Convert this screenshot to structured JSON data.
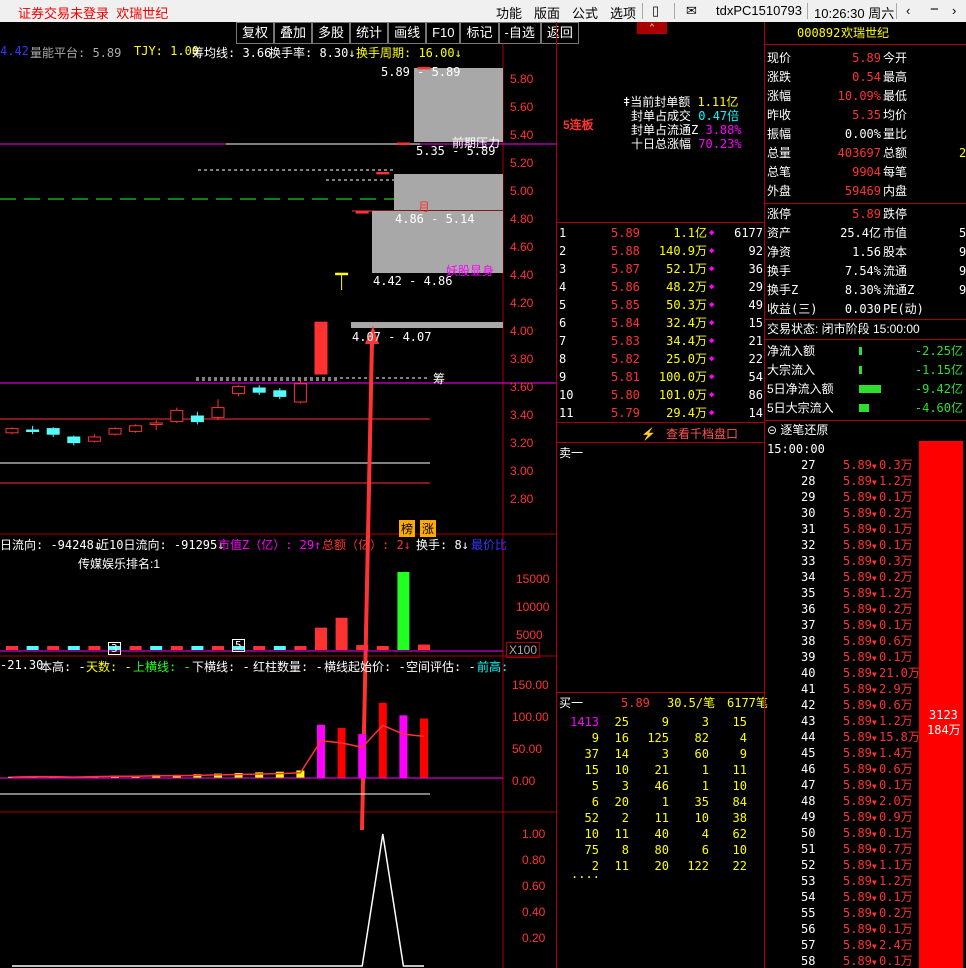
{
  "topbar": {
    "warning": "证券交易未登录",
    "stock_name": "欢瑞世纪",
    "menus": [
      "功能",
      "版面",
      "公式",
      "选项"
    ],
    "host": "tdxPC1510793",
    "time": "10:26:30 周六"
  },
  "menu": [
    "复权",
    "叠加",
    "多股",
    "统计",
    "画线",
    "F10",
    "标记",
    "-自选",
    "返回"
  ],
  "indicators": {
    "row1": [
      {
        "t": "4.42",
        "c": "#33f"
      },
      {
        "t": "量能平台: 5.89",
        "c": "#aaa"
      },
      {
        "t": "TJY: 1.00",
        "c": "#ff0"
      },
      {
        "t": "筹均线: 3.66",
        "c": "#fff"
      },
      {
        "t": "换手率: 8.30↓",
        "c": "#fff"
      },
      {
        "t": "换手周期: 16.00↓",
        "c": "#ff0"
      }
    ],
    "row2": [
      {
        "t": "日流向: -94248↓",
        "c": "#fff"
      },
      {
        "t": "近10日流向: -91295↓",
        "c": "#fff"
      },
      {
        "t": "市值Z（亿）: 29↑",
        "c": "#f0f"
      },
      {
        "t": "总额（亿）: 2↓",
        "c": "#f33"
      },
      {
        "t": "换手: 8↓",
        "c": "#fff"
      },
      {
        "t": "最价比",
        "c": "#33f"
      }
    ],
    "row3": [
      {
        "t": "-21.30",
        "c": "#fff"
      },
      {
        "t": "本高: -",
        "c": "#fff"
      },
      {
        "t": "天数: -",
        "c": "#ff0"
      },
      {
        "t": "上横线: -",
        "c": "#2f2"
      },
      {
        "t": "下横线: -",
        "c": "#fff"
      },
      {
        "t": "红柱数量: -",
        "c": "#fff"
      },
      {
        "t": "横线起始价: -",
        "c": "#fff"
      },
      {
        "t": "空间评估: -",
        "c": "#fff"
      },
      {
        "t": "前高:",
        "c": "#0ff"
      }
    ]
  },
  "price_axis": [
    "5.80",
    "5.60",
    "5.40",
    "5.20",
    "5.00",
    "4.80",
    "4.60",
    "4.40",
    "4.20",
    "4.00",
    "3.80",
    "3.60",
    "3.40",
    "3.20",
    "3.00",
    "2.80"
  ],
  "vol_axis": [
    "15000",
    "10000",
    "5000",
    "X100"
  ],
  "ind_axis": [
    "150.00",
    "100.00",
    "50.00",
    "0.00"
  ],
  "bot_axis": [
    "1.00",
    "0.80",
    "0.60",
    "0.40",
    "0.20"
  ],
  "annotations": {
    "p1": "5.89 - 5.89",
    "p2": "前期压力",
    "p3": "5.35 - 5.89",
    "p4": "4.86 - 5.14",
    "p5": "月",
    "p6": "妖股显身",
    "p7": "4.42 - 4.86",
    "p8": "4.07 - 4.07",
    "p9": "筹",
    "rank": "传媒娱乐排名:1",
    "bang": "榜",
    "zhang": "涨",
    "box3": "3",
    "box5": "5"
  },
  "mid": {
    "limit_tag": "5连板",
    "seal": [
      {
        "l": "当前封单额",
        "v": "1.11亿"
      },
      {
        "l": "封单占成交",
        "v": "0.47倍"
      },
      {
        "l": "封单占流通Z",
        "v": "3.88%"
      },
      {
        "l": "十日总涨幅",
        "v": "70.23%"
      }
    ],
    "queue": [
      [
        "1",
        "5.89",
        "1.1亿",
        "6177"
      ],
      [
        "2",
        "5.88",
        "140.9万",
        "92"
      ],
      [
        "3",
        "5.87",
        "52.1万",
        "36"
      ],
      [
        "4",
        "5.86",
        "48.2万",
        "29"
      ],
      [
        "5",
        "5.85",
        "50.3万",
        "49"
      ],
      [
        "6",
        "5.84",
        "32.4万",
        "15"
      ],
      [
        "7",
        "5.83",
        "34.4万",
        "21"
      ],
      [
        "8",
        "5.82",
        "25.0万",
        "22"
      ],
      [
        "9",
        "5.81",
        "100.0万",
        "54"
      ],
      [
        "10",
        "5.80",
        "101.0万",
        "86"
      ],
      [
        "11",
        "5.79",
        "29.4万",
        "14"
      ]
    ],
    "depth_link": "查看千档盘口",
    "sell1": "卖一",
    "buy1": [
      "买一",
      "5.89",
      "30.5/笔",
      "6177笔"
    ],
    "orders": [
      [
        "1413",
        "25",
        "9",
        "3",
        "15"
      ],
      [
        "9",
        "16",
        "125",
        "82",
        "4"
      ],
      [
        "37",
        "14",
        "3",
        "60",
        "9"
      ],
      [
        "15",
        "10",
        "21",
        "1",
        "11"
      ],
      [
        "5",
        "3",
        "46",
        "1",
        "10"
      ],
      [
        "6",
        "20",
        "1",
        "35",
        "84"
      ],
      [
        "52",
        "2",
        "11",
        "10",
        "38"
      ],
      [
        "10",
        "11",
        "40",
        "4",
        "62"
      ],
      [
        "75",
        "8",
        "80",
        "6",
        "10"
      ],
      [
        "2",
        "11",
        "20",
        "122",
        "22"
      ]
    ],
    "dots": "...."
  },
  "right": {
    "code": "000892",
    "name": "欢瑞世纪",
    "quote": [
      [
        "现价",
        "5.89",
        "今开",
        ""
      ],
      [
        "涨跌",
        "0.54",
        "最高",
        ""
      ],
      [
        "涨幅",
        "10.09%",
        "最低",
        ""
      ],
      [
        "昨收",
        "5.35",
        "均价",
        ""
      ],
      [
        "振幅",
        "0.00%",
        "量比",
        ""
      ],
      [
        "总量",
        "403697",
        "总额",
        "2"
      ],
      [
        "总笔",
        "9904",
        "每笔",
        ""
      ],
      [
        "外盘",
        "59469",
        "内盘",
        ""
      ]
    ],
    "fund": [
      [
        "涨停",
        "5.89",
        "跌停",
        ""
      ],
      [
        "资产",
        "25.4亿",
        "市值",
        "5"
      ],
      [
        "净资",
        "1.56",
        "股本",
        "9"
      ],
      [
        "换手",
        "7.54%",
        "流通",
        "9"
      ],
      [
        "换手Z",
        "8.30%",
        "流通Z",
        "9"
      ],
      [
        "收益(三)",
        "0.030",
        "PE(动)",
        ""
      ]
    ],
    "status": "交易状态: 闭市阶段 15:00:00",
    "flows": [
      [
        "净流入额",
        "-2.25亿"
      ],
      [
        "大宗流入",
        "-1.15亿"
      ],
      [
        "5日净流入额",
        "-9.42亿"
      ],
      [
        "5日大宗流入",
        "-4.60亿"
      ]
    ],
    "tick_title": "逐笔还原",
    "ticks": [
      [
        "15:00:00",
        "",
        ""
      ],
      [
        "27",
        "5.89",
        "0.3万"
      ],
      [
        "28",
        "5.89",
        "1.2万"
      ],
      [
        "29",
        "5.89",
        "0.1万"
      ],
      [
        "30",
        "5.89",
        "0.2万"
      ],
      [
        "31",
        "5.89",
        "0.1万"
      ],
      [
        "32",
        "5.89",
        "0.1万"
      ],
      [
        "33",
        "5.89",
        "0.3万"
      ],
      [
        "34",
        "5.89",
        "0.2万"
      ],
      [
        "35",
        "5.89",
        "1.2万"
      ],
      [
        "36",
        "5.89",
        "0.2万"
      ],
      [
        "37",
        "5.89",
        "0.1万"
      ],
      [
        "38",
        "5.89",
        "0.6万"
      ],
      [
        "39",
        "5.89",
        "0.1万"
      ],
      [
        "40",
        "5.89",
        "21.0万"
      ],
      [
        "41",
        "5.89",
        "2.9万"
      ],
      [
        "42",
        "5.89",
        "0.6万"
      ],
      [
        "43",
        "5.89",
        "1.2万"
      ],
      [
        "44",
        "5.89",
        "15.8万"
      ],
      [
        "45",
        "5.89",
        "1.4万"
      ],
      [
        "46",
        "5.89",
        "0.6万"
      ],
      [
        "47",
        "5.89",
        "0.1万"
      ],
      [
        "48",
        "5.89",
        "2.0万"
      ],
      [
        "49",
        "5.89",
        "0.9万"
      ],
      [
        "50",
        "5.89",
        "0.1万"
      ],
      [
        "51",
        "5.89",
        "0.7万"
      ],
      [
        "52",
        "5.89",
        "1.1万"
      ],
      [
        "53",
        "5.89",
        "1.2万"
      ],
      [
        "54",
        "5.89",
        "0.1万"
      ],
      [
        "55",
        "5.89",
        "0.2万"
      ],
      [
        "56",
        "5.89",
        "0.1万"
      ],
      [
        "57",
        "5.89",
        "2.4万"
      ],
      [
        "58",
        "5.89",
        "0.1万"
      ]
    ],
    "big_order": [
      "3123",
      "184万"
    ]
  },
  "colors": {
    "up": "#ff3232",
    "down": "#54fcfc",
    "bg": "#000000",
    "frame": "#aa0000"
  },
  "chart_data": {
    "type": "candlestick",
    "ylim": [
      2.7,
      5.9
    ],
    "candles": [
      [
        3.28,
        3.31,
        3.32,
        3.27
      ],
      [
        3.3,
        3.29,
        3.33,
        3.27
      ],
      [
        3.31,
        3.27,
        3.32,
        3.25
      ],
      [
        3.25,
        3.21,
        3.26,
        3.19
      ],
      [
        3.22,
        3.25,
        3.27,
        3.21
      ],
      [
        3.27,
        3.31,
        3.32,
        3.26
      ],
      [
        3.29,
        3.33,
        3.34,
        3.28
      ],
      [
        3.35,
        3.35,
        3.37,
        3.3
      ],
      [
        3.36,
        3.44,
        3.46,
        3.35
      ],
      [
        3.4,
        3.36,
        3.43,
        3.34
      ],
      [
        3.39,
        3.46,
        3.52,
        3.37
      ],
      [
        3.56,
        3.61,
        3.62,
        3.54
      ],
      [
        3.6,
        3.57,
        3.62,
        3.55
      ],
      [
        3.58,
        3.54,
        3.6,
        3.52
      ],
      [
        3.5,
        3.63,
        3.65,
        3.49
      ],
      [
        3.7,
        4.07,
        4.07,
        3.7
      ],
      [
        4.42,
        4.42,
        4.42,
        4.3
      ],
      [
        4.86,
        4.86,
        4.86,
        4.86
      ],
      [
        5.14,
        5.14,
        5.14,
        5.14
      ],
      [
        5.35,
        5.35,
        5.35,
        5.35
      ],
      [
        5.89,
        5.89,
        5.89,
        5.89
      ]
    ],
    "volume": [
      6,
      6,
      6,
      6,
      6,
      6,
      6,
      6,
      6,
      6,
      6,
      6,
      6,
      6,
      6,
      4300,
      6200,
      950,
      420,
      15000,
      1050
    ],
    "osc": [
      2,
      3,
      3,
      2,
      3,
      4,
      4,
      5,
      5,
      6,
      7,
      8,
      9,
      10,
      12,
      85,
      80,
      70,
      120,
      100,
      95
    ],
    "bottom": [
      0,
      0,
      0,
      0,
      0,
      0,
      0,
      0,
      0,
      0,
      0,
      0,
      0,
      0,
      0,
      0,
      0,
      0,
      1,
      0,
      0
    ]
  }
}
